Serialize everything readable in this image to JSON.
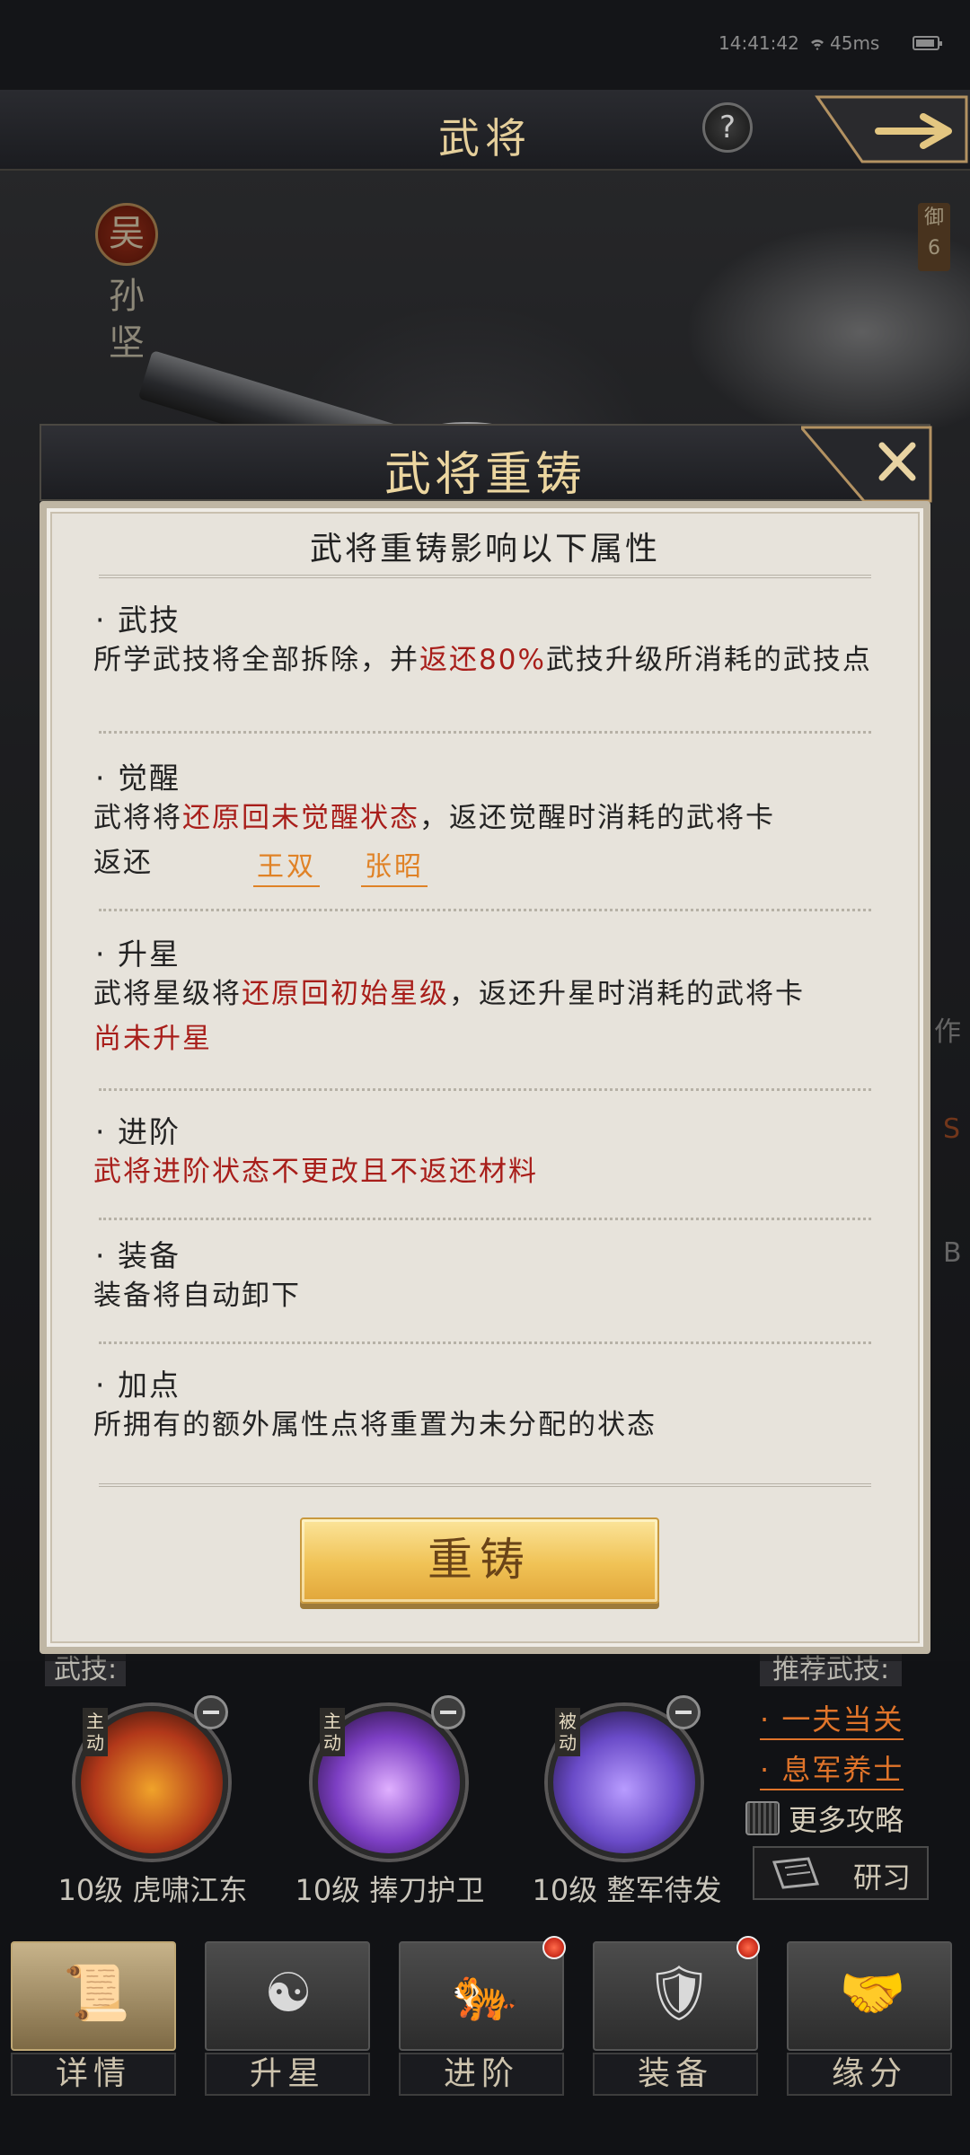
{
  "status_bar": {
    "time": "14:41:42",
    "ping": "45ms"
  },
  "header": {
    "title": "武将",
    "help_label": "?"
  },
  "hero": {
    "faction": "吴",
    "name": "孙坚",
    "defense_label": "御",
    "defense_value": "6"
  },
  "modal": {
    "title": "武将重铸",
    "subtitle": "武将重铸影响以下属性",
    "sections": {
      "wuji": {
        "heading": "· 武技",
        "text_a": "所学武技将全部拆除，并",
        "text_b": "返还80%",
        "text_c": "武技升级所消耗的武技点"
      },
      "juexing": {
        "heading": "· 觉醒",
        "text_a": "武将将",
        "text_b": "还原回未觉醒状态",
        "text_c": "，返还觉醒时消耗的武将卡",
        "return_label": "返还",
        "cards": [
          "王双",
          "张昭"
        ]
      },
      "shengxing": {
        "heading": "· 升星",
        "text_a": "武将星级将",
        "text_b": "还原回初始星级",
        "text_c": "，返还升星时消耗的武将卡",
        "note": "尚未升星"
      },
      "jinjie": {
        "heading": "· 进阶",
        "text": "武将进阶状态不更改且不返还材料"
      },
      "zhuangbei": {
        "heading": "· 装备",
        "text": "装备将自动卸下"
      },
      "jiadian": {
        "heading": "· 加点",
        "text": "所拥有的额外属性点将重置为未分配的状态"
      }
    },
    "confirm_label": "重铸"
  },
  "skills": {
    "label": "武技:",
    "items": [
      {
        "tag": "主动",
        "name": "10级 虎啸江东",
        "color": "#d9572a"
      },
      {
        "tag": "主动",
        "name": "10级 捧刀护卫",
        "color": "#7d3fc4"
      },
      {
        "tag": "被动",
        "name": "10级 整军待发",
        "color": "#6a4bc8"
      }
    ]
  },
  "recommend": {
    "label": "推荐武技:",
    "links": [
      "· 一夫当关",
      "· 息军养士"
    ],
    "more": "更多攻略",
    "study": "研习"
  },
  "nav": {
    "items": [
      {
        "label": "详情",
        "icon": "scroll-icon",
        "badge": false
      },
      {
        "label": "升星",
        "icon": "bagua-icon",
        "badge": false
      },
      {
        "label": "进阶",
        "icon": "tiger-icon",
        "badge": true
      },
      {
        "label": "装备",
        "icon": "shield-icon",
        "badge": true
      },
      {
        "label": "缘分",
        "icon": "handshake-icon",
        "badge": false
      }
    ]
  },
  "side_tags": [
    "作",
    "S",
    "B"
  ]
}
